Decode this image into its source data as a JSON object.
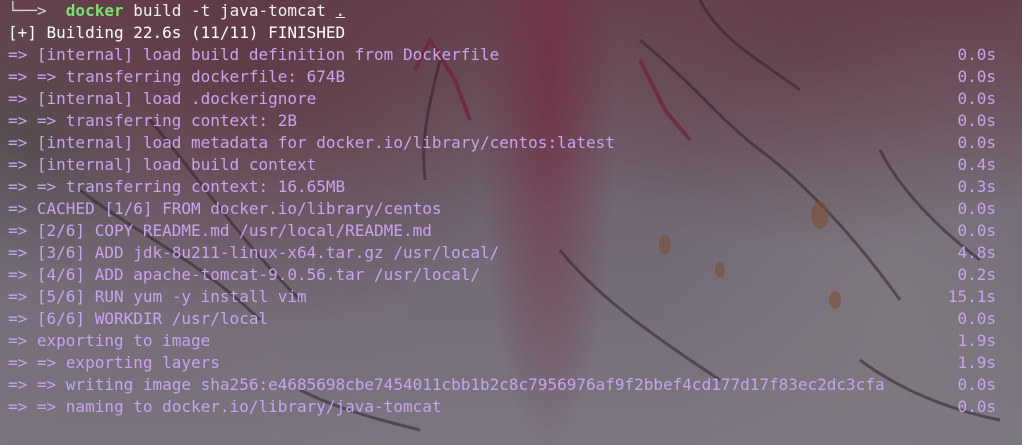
{
  "prompt": {
    "arrow": "└──>",
    "command": "docker",
    "args": "build -t java-tomcat",
    "context": "."
  },
  "status_line": "[+] Building 22.6s (11/11) FINISHED",
  "steps": [
    {
      "text": "=> [internal] load build definition from Dockerfile",
      "time": "0.0s"
    },
    {
      "text": "=> => transferring dockerfile: 674B",
      "time": "0.0s"
    },
    {
      "text": "=> [internal] load .dockerignore",
      "time": "0.0s"
    },
    {
      "text": "=> => transferring context: 2B",
      "time": "0.0s"
    },
    {
      "text": "=> [internal] load metadata for docker.io/library/centos:latest",
      "time": "0.0s"
    },
    {
      "text": "=> [internal] load build context",
      "time": "0.4s"
    },
    {
      "text": "=> => transferring context: 16.65MB",
      "time": "0.3s"
    },
    {
      "text": "=> CACHED [1/6] FROM docker.io/library/centos",
      "time": "0.0s"
    },
    {
      "text": "=> [2/6] COPY README.md /usr/local/README.md",
      "time": "0.0s"
    },
    {
      "text": "=> [3/6] ADD jdk-8u211-linux-x64.tar.gz /usr/local/",
      "time": "4.8s"
    },
    {
      "text": "=> [4/6] ADD apache-tomcat-9.0.56.tar /usr/local/",
      "time": "0.2s"
    },
    {
      "text": "=> [5/6] RUN yum -y install vim",
      "time": "15.1s"
    },
    {
      "text": "=> [6/6] WORKDIR /usr/local",
      "time": "0.0s"
    },
    {
      "text": "=> exporting to image",
      "time": "1.9s"
    },
    {
      "text": "=> => exporting layers",
      "time": "1.9s"
    },
    {
      "text": "=> => writing image sha256:e4685698cbe7454011cbb1b2c8c7956976af9f2bbef4cd177d17f83ec2dc3cfa",
      "time": "0.0s"
    },
    {
      "text": "=> => naming to docker.io/library/java-tomcat",
      "time": "0.0s"
    }
  ],
  "colors": {
    "command": "#7be36b",
    "step_text": "#c6a4ee",
    "status": "#ffffff"
  }
}
